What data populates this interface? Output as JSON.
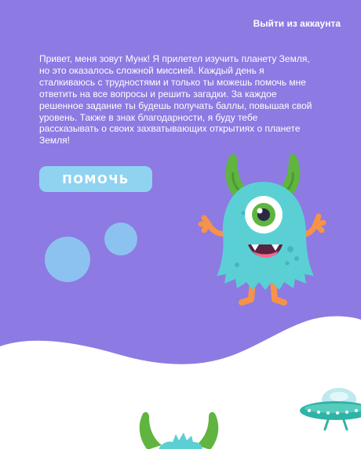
{
  "header": {
    "logout_label": "Выйти из аккаунта"
  },
  "intro": {
    "text": "Привет, меня зовут Мунк! Я прилетел изучить планету Земля, но это оказалось сложной миссией. Каждый день я сталкиваюсь с трудностями и только ты можешь помочь мне ответить на все вопросы и решить загадки. За каждое решенное задание ты будешь получать баллы, повышая свой уровень. Также в знак благодарности, я буду тебе рассказывать о своих захватывающих открытиях о планете Земля!"
  },
  "actions": {
    "help_label": "ПОМОЧЬ"
  },
  "colors": {
    "background_purple": "#8d7ae3",
    "ground_white": "#ffffff",
    "button_fill": "#8fd3f1",
    "bubble_blue": "#8cc2f0",
    "monster_teal": "#5ad0d4",
    "horn_green": "#5fb53f",
    "limb_orange": "#f6924a",
    "ufo_teal": "#2fb3a6"
  },
  "icons": {
    "mascot": "monster-mascot",
    "ship": "ufo-icon",
    "second_mascot": "monster-peek"
  }
}
